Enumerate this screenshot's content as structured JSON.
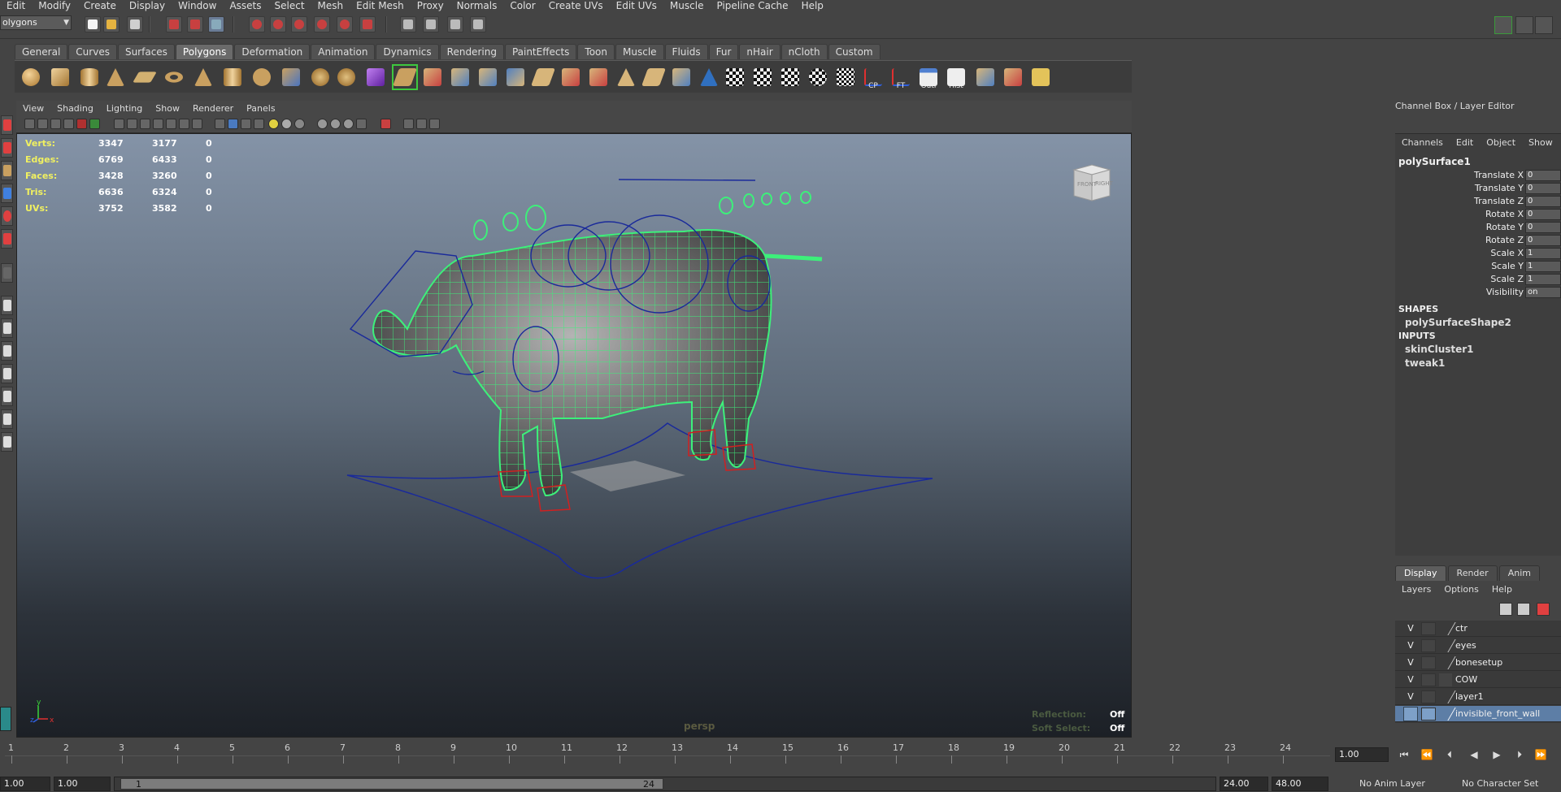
{
  "menubar": [
    "Edit",
    "Modify",
    "Create",
    "Display",
    "Window",
    "Assets",
    "Select",
    "Mesh",
    "Edit Mesh",
    "Proxy",
    "Normals",
    "Color",
    "Create UVs",
    "Edit UVs",
    "Muscle",
    "Pipeline Cache",
    "Help"
  ],
  "status": {
    "mode": "olygons"
  },
  "shelf_tabs": [
    "General",
    "Curves",
    "Surfaces",
    "Polygons",
    "Deformation",
    "Animation",
    "Dynamics",
    "Rendering",
    "PaintEffects",
    "Toon",
    "Muscle",
    "Fluids",
    "Fur",
    "nHair",
    "nCloth",
    "Custom"
  ],
  "shelf_active": "Polygons",
  "shelf_labels": {
    "cp": "CP",
    "ft": "FT",
    "outl": "Outl",
    "hist": "Hist"
  },
  "panel_menu": [
    "View",
    "Shading",
    "Lighting",
    "Show",
    "Renderer",
    "Panels"
  ],
  "hud": {
    "rows": [
      {
        "k": "Verts:",
        "a": "3347",
        "b": "3177",
        "c": "0"
      },
      {
        "k": "Edges:",
        "a": "6769",
        "b": "6433",
        "c": "0"
      },
      {
        "k": "Faces:",
        "a": "3428",
        "b": "3260",
        "c": "0"
      },
      {
        "k": "Tris:",
        "a": "6636",
        "b": "6324",
        "c": "0"
      },
      {
        "k": "UVs:",
        "a": "3752",
        "b": "3582",
        "c": "0"
      }
    ],
    "camera": "persp",
    "reflection_label": "Reflection:",
    "reflection_value": "Off",
    "soft_select_label": "Soft Select:",
    "soft_select_value": "Off",
    "viewcube_front": "FRONT",
    "viewcube_right": "RIGHT",
    "axis_y": "y",
    "axis_z": "z",
    "axis_x": "x"
  },
  "channel_box": {
    "title": "Channel Box / Layer Editor",
    "menu": [
      "Channels",
      "Edit",
      "Object",
      "Show"
    ],
    "object": "polySurface1",
    "attributes": [
      {
        "name": "Translate X",
        "value": "0"
      },
      {
        "name": "Translate Y",
        "value": "0"
      },
      {
        "name": "Translate Z",
        "value": "0"
      },
      {
        "name": "Rotate X",
        "value": "0"
      },
      {
        "name": "Rotate Y",
        "value": "0"
      },
      {
        "name": "Rotate Z",
        "value": "0"
      },
      {
        "name": "Scale X",
        "value": "1"
      },
      {
        "name": "Scale Y",
        "value": "1"
      },
      {
        "name": "Scale Z",
        "value": "1"
      },
      {
        "name": "Visibility",
        "value": "on"
      }
    ],
    "shapes_label": "SHAPES",
    "shape": "polySurfaceShape2",
    "inputs_label": "INPUTS",
    "inputs": [
      "skinCluster1",
      "tweak1"
    ]
  },
  "layer_editor": {
    "tabs": [
      "Display",
      "Render",
      "Anim"
    ],
    "menu": [
      "Layers",
      "Options",
      "Help"
    ],
    "layers": [
      {
        "vis": "V",
        "name": "ctr"
      },
      {
        "vis": "V",
        "name": "eyes"
      },
      {
        "vis": "V",
        "name": "bonesetup"
      },
      {
        "vis": "V",
        "name": "COW"
      },
      {
        "vis": "V",
        "name": "layer1"
      },
      {
        "vis": "",
        "name": "invisible_front_wall"
      }
    ]
  },
  "time_slider": {
    "ticks": [
      "1",
      "2",
      "3",
      "4",
      "5",
      "6",
      "7",
      "8",
      "9",
      "10",
      "11",
      "12",
      "13",
      "14",
      "15",
      "16",
      "17",
      "18",
      "19",
      "20",
      "21",
      "22",
      "23",
      "24"
    ],
    "current_frame": "1.00"
  },
  "range": {
    "start": "1.00",
    "inner_start": "1.00",
    "handle_start": "1",
    "handle_end": "24",
    "end": "24.00",
    "outer_end": "48.00",
    "anim_layer": "No Anim Layer",
    "character_set": "No Character Set"
  },
  "colors": {
    "wire": "#3df07a",
    "control": "#1a2a9a",
    "ik": "#d02020",
    "hud_key": "#f0f060",
    "selected_layer": "#5d7ea6"
  }
}
